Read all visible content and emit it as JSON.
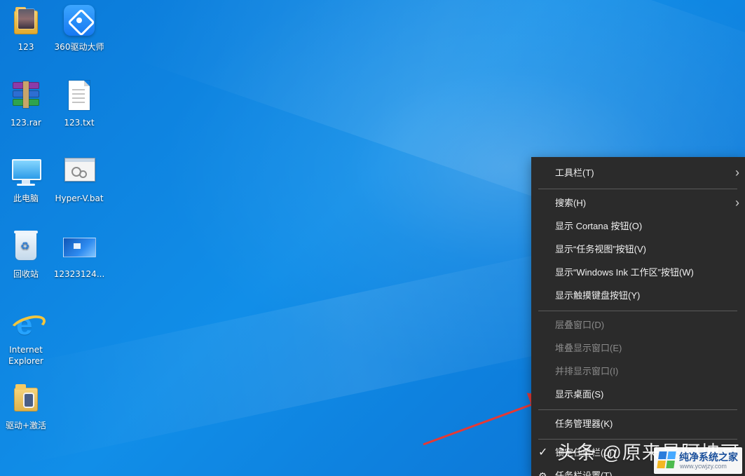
{
  "desktop": {
    "icons": [
      {
        "label": "123",
        "icon": "folder-photo-icon"
      },
      {
        "label": "360驱动大师",
        "icon": "app-360-icon"
      },
      {
        "label": "123.rar",
        "icon": "rar-archive-icon"
      },
      {
        "label": "123.txt",
        "icon": "text-file-icon"
      },
      {
        "label": "此电脑",
        "icon": "computer-icon"
      },
      {
        "label": "Hyper-V.bat",
        "icon": "batch-file-icon"
      },
      {
        "label": "回收站",
        "icon": "recycle-bin-icon"
      },
      {
        "label": "12323124...",
        "icon": "image-thumbnail-icon"
      },
      {
        "label": "Internet\nExplorer",
        "icon": "internet-explorer-icon"
      },
      {
        "label": "驱动+激活",
        "icon": "folder-driver-icon"
      }
    ]
  },
  "context_menu": {
    "items": [
      {
        "label": "工具栏(T)",
        "enabled": true,
        "submenu": true,
        "submenu_glyph": "›"
      },
      {
        "label": "搜索(H)",
        "enabled": true,
        "submenu": true,
        "submenu_glyph": "›"
      },
      {
        "label": "显示 Cortana 按钮(O)",
        "enabled": true,
        "submenu": false
      },
      {
        "label": "显示“任务视图”按钮(V)",
        "enabled": true,
        "submenu": false
      },
      {
        "label": "显示“Windows Ink 工作区”按钮(W)",
        "enabled": true,
        "submenu": false
      },
      {
        "label": "显示触摸键盘按钮(Y)",
        "enabled": true,
        "submenu": false
      },
      {
        "label": "层叠窗口(D)",
        "enabled": false,
        "submenu": false
      },
      {
        "label": "堆叠显示窗口(E)",
        "enabled": false,
        "submenu": false
      },
      {
        "label": "并排显示窗口(I)",
        "enabled": false,
        "submenu": false
      },
      {
        "label": "显示桌面(S)",
        "enabled": true,
        "submenu": false
      },
      {
        "label": "任务管理器(K)",
        "enabled": true,
        "submenu": false
      },
      {
        "label": "锁定任务栏(L)",
        "enabled": true,
        "submenu": false,
        "checked": true,
        "check_glyph": "✓"
      },
      {
        "label": "任务栏设置(T)",
        "enabled": true,
        "submenu": false,
        "settings_glyph": "⚙"
      }
    ]
  },
  "annotation": {
    "arrow_color": "#e53935"
  },
  "watermark": {
    "main_text": "头条 @原来是阿坤可",
    "logo_text": "纯净系统之家",
    "logo_url": "www.ycwjzy.com"
  }
}
